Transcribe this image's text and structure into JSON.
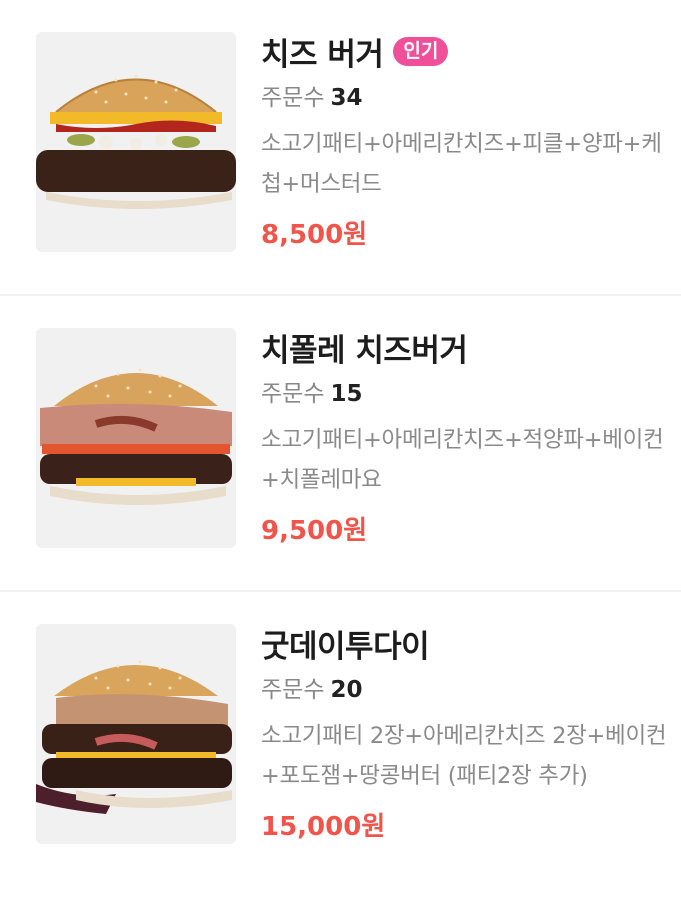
{
  "menu": {
    "items": [
      {
        "name": "치즈 버거",
        "badge": "인기",
        "orders_label": "주문수",
        "orders_count": "34",
        "description": "소고기패티+아메리칸치즈+피클+양파+케첩+머스터드",
        "price": "8,500원",
        "image": "cheese-burger-image"
      },
      {
        "name": "치폴레 치즈버거",
        "orders_label": "주문수",
        "orders_count": "15",
        "description": "소고기패티+아메리칸치즈+적양파+베이컨+치폴레마요",
        "price": "9,500원",
        "image": "chipotle-cheese-burger-image"
      },
      {
        "name": "굿데이투다이",
        "orders_label": "주문수",
        "orders_count": "20",
        "description": "소고기패티 2장+아메리칸치즈 2장+베이컨+포도잼+땅콩버터 (패티2장 추가)",
        "price": "15,000원",
        "image": "good-day-to-die-burger-image"
      }
    ]
  },
  "colors": {
    "badge": "#f0509a",
    "price": "#f0554b",
    "muted_text": "#888888",
    "divider": "#f2f2f2"
  }
}
